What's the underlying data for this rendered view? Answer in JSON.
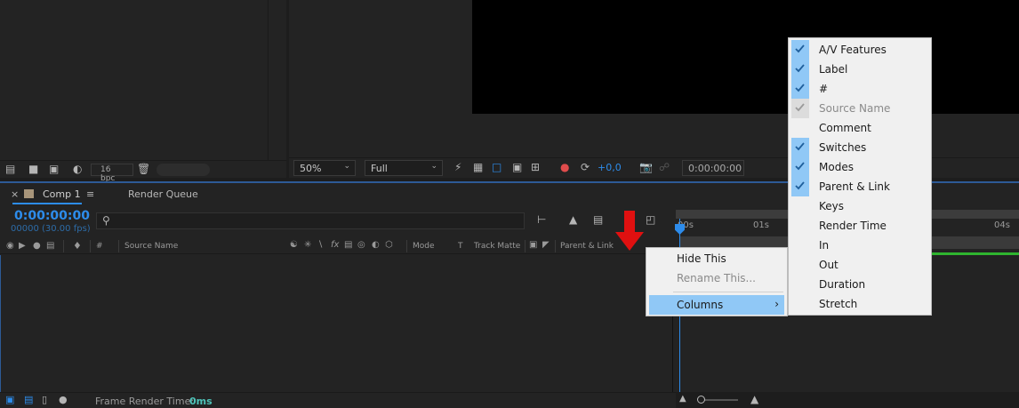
{
  "project_footer": {
    "bpc_label": "16 bpc"
  },
  "viewer": {
    "zoom": "50%",
    "resolution": "Full",
    "exposure": "+0,0",
    "timecode": "0:00:00:00"
  },
  "timeline": {
    "tab_comp": "Comp 1",
    "tab_render_queue": "Render Queue",
    "timecode": "0:00:00:00",
    "fps_readout": "00000 (30.00 fps)",
    "search_placeholder": "",
    "columns": {
      "hash": "#",
      "source_name": "Source Name",
      "mode": "Mode",
      "t": "T",
      "track_matte": "Track Matte",
      "parent_link": "Parent & Link"
    },
    "ruler_ticks": [
      "00s",
      "01s",
      "04s"
    ],
    "footer_label": "Frame Render Time:",
    "footer_value": "0ms"
  },
  "context_menu": {
    "items": [
      {
        "label": "Hide This",
        "disabled": false
      },
      {
        "label": "Rename This...",
        "disabled": true
      },
      {
        "label": "Columns",
        "disabled": false,
        "has_submenu": true
      }
    ]
  },
  "columns_submenu": {
    "items": [
      {
        "label": "A/V Features",
        "checked": true
      },
      {
        "label": "Label",
        "checked": true
      },
      {
        "label": "#",
        "checked": true
      },
      {
        "label": "Source Name",
        "checked": true,
        "disabled": true
      },
      {
        "label": "Comment",
        "checked": false
      },
      {
        "label": "Switches",
        "checked": true
      },
      {
        "label": "Modes",
        "checked": true
      },
      {
        "label": "Parent & Link",
        "checked": true
      },
      {
        "label": "Keys",
        "checked": false
      },
      {
        "label": "Render Time",
        "checked": false
      },
      {
        "label": "In",
        "checked": false
      },
      {
        "label": "Out",
        "checked": false
      },
      {
        "label": "Duration",
        "checked": false
      },
      {
        "label": "Stretch",
        "checked": false
      }
    ]
  },
  "colors": {
    "accent": "#2d8ceb",
    "menu_highlight": "#90c8f6",
    "annotation_arrow": "#e01010",
    "work_area_green": "#2fb52f"
  }
}
